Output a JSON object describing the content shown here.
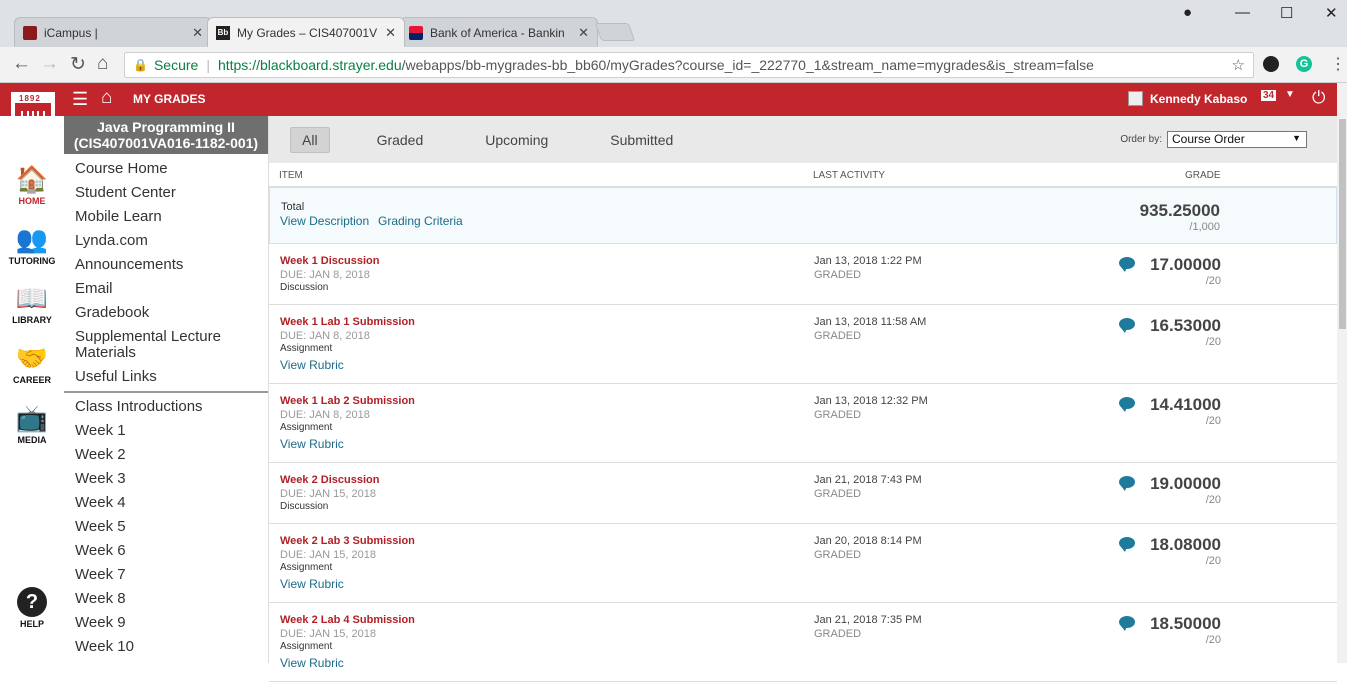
{
  "browser": {
    "tabs": [
      {
        "title": "iCampus |"
      },
      {
        "title": "My Grades – CIS407001V"
      },
      {
        "title": "Bank of America - Bankin"
      }
    ],
    "secure_label": "Secure",
    "url_host": "https://blackboard.strayer.edu",
    "url_path": "/webapps/bb-mygrades-bb_bb60/myGrades?course_id=_222770_1&stream_name=mygrades&is_stream=false"
  },
  "bb": {
    "section_title": "MY GRADES",
    "user_name": "Kennedy Kabaso",
    "notification_count": "34",
    "logo_year": "1892",
    "accent": "#c1262d"
  },
  "icon_nav": [
    {
      "label": "HOME",
      "icon": "home-icon"
    },
    {
      "label": "TUTORING",
      "icon": "people-icon"
    },
    {
      "label": "LIBRARY",
      "icon": "book-icon"
    },
    {
      "label": "CAREER",
      "icon": "handshake-icon"
    },
    {
      "label": "MEDIA",
      "icon": "tv-icon"
    },
    {
      "label": "HELP",
      "icon": "help-icon"
    }
  ],
  "course": {
    "title": "Java Programming II",
    "code": "(CIS407001VA016-1182-001)",
    "links_top": [
      "Course Home",
      "Student Center",
      "Mobile Learn",
      "Lynda.com",
      "Announcements",
      "Email",
      "Gradebook",
      "Supplemental Lecture Materials",
      "Useful Links"
    ],
    "links_bottom": [
      "Class Introductions",
      "Week 1",
      "Week 2",
      "Week 3",
      "Week 4",
      "Week 5",
      "Week 6",
      "Week 7",
      "Week 8",
      "Week 9",
      "Week 10"
    ]
  },
  "filters": {
    "all": "All",
    "graded": "Graded",
    "upcoming": "Upcoming",
    "submitted": "Submitted",
    "order_by_label": "Order by:",
    "order_by_value": "Course Order"
  },
  "columns": {
    "item": "ITEM",
    "last_activity": "LAST ACTIVITY",
    "grade": "GRADE"
  },
  "total": {
    "label": "Total",
    "view_description": "View Description",
    "grading_criteria": "Grading Criteria",
    "grade": "935.25000",
    "out_of": "/1,000"
  },
  "items": [
    {
      "title": "Week 1 Discussion",
      "due": "DUE: JAN 8, 2018",
      "type": "Discussion",
      "rubric": "",
      "date": "Jan 13, 2018 1:22 PM",
      "status": "GRADED",
      "grade": "17.00000",
      "out_of": "/20"
    },
    {
      "title": "Week 1 Lab 1 Submission",
      "due": "DUE: JAN 8, 2018",
      "type": "Assignment",
      "rubric": "View Rubric",
      "date": "Jan 13, 2018 11:58 AM",
      "status": "GRADED",
      "grade": "16.53000",
      "out_of": "/20"
    },
    {
      "title": "Week 1 Lab 2 Submission",
      "due": "DUE: JAN 8, 2018",
      "type": "Assignment",
      "rubric": "View Rubric",
      "date": "Jan 13, 2018 12:32 PM",
      "status": "GRADED",
      "grade": "14.41000",
      "out_of": "/20"
    },
    {
      "title": "Week 2 Discussion",
      "due": "DUE: JAN 15, 2018",
      "type": "Discussion",
      "rubric": "",
      "date": "Jan 21, 2018 7:43 PM",
      "status": "GRADED",
      "grade": "19.00000",
      "out_of": "/20"
    },
    {
      "title": "Week 2 Lab 3 Submission",
      "due": "DUE: JAN 15, 2018",
      "type": "Assignment",
      "rubric": "View Rubric",
      "date": "Jan 20, 2018 8:14 PM",
      "status": "GRADED",
      "grade": "18.08000",
      "out_of": "/20"
    },
    {
      "title": "Week 2 Lab 4 Submission",
      "due": "DUE: JAN 15, 2018",
      "type": "Assignment",
      "rubric": "View Rubric",
      "date": "Jan 21, 2018 7:35 PM",
      "status": "GRADED",
      "grade": "18.50000",
      "out_of": "/20"
    }
  ]
}
